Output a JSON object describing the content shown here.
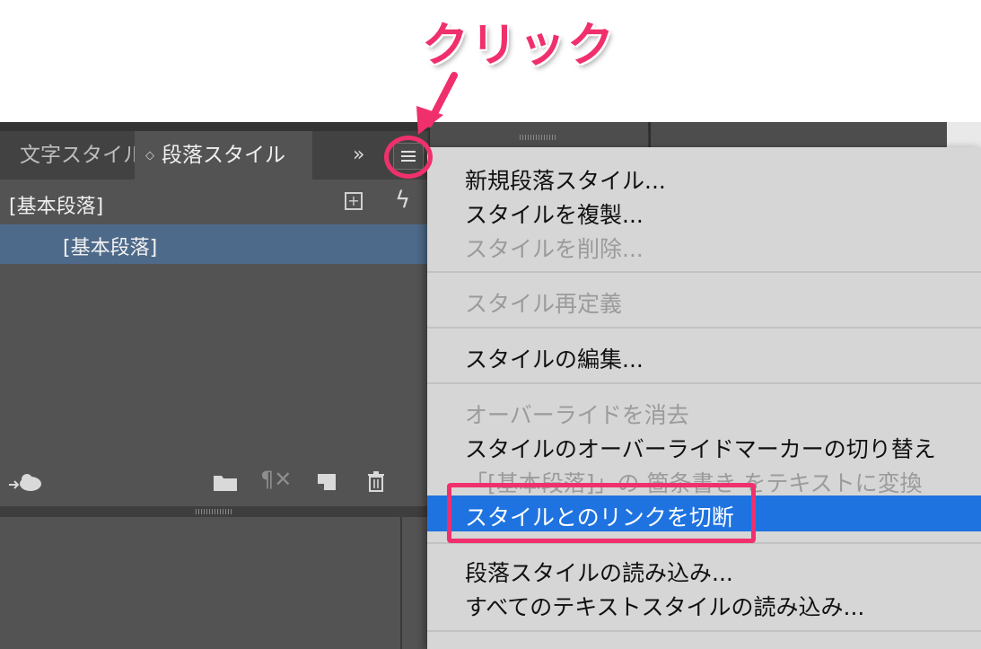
{
  "callout": {
    "text": "クリック",
    "color": "#f0306c"
  },
  "panel": {
    "tabs": [
      {
        "label": "文字スタイル"
      },
      {
        "label": "段落スタイル",
        "active": true
      }
    ],
    "tab_arrows_glyph": "◇",
    "overflow_glyph": "»",
    "header_label": "[基本段落]",
    "styles": [
      {
        "label": "[基本段落]",
        "selected": true
      }
    ],
    "selection_color": "#4e6a8a"
  },
  "menu": {
    "items": [
      {
        "label": "新規段落スタイル...",
        "enabled": true
      },
      {
        "label": "スタイルを複製...",
        "enabled": true
      },
      {
        "label": "スタイルを削除...",
        "enabled": false
      },
      {
        "label": "スタイル再定義",
        "enabled": false
      },
      {
        "label": "スタイルの編集...",
        "enabled": true
      },
      {
        "label": "オーバーライドを消去",
        "enabled": false
      },
      {
        "label": "スタイルのオーバーライドマーカーの切り替え",
        "enabled": true
      },
      {
        "label": "「[基本段落]」の 箇条書き をテキストに変換",
        "enabled": false
      },
      {
        "label": "スタイルとのリンクを切断",
        "enabled": true,
        "highlighted": true
      },
      {
        "label": "段落スタイルの読み込み...",
        "enabled": true
      },
      {
        "label": "すべてのテキストスタイルの読み込み...",
        "enabled": true
      }
    ],
    "highlight_color": "#1e73e0"
  },
  "annotation_color": "#f0306c"
}
